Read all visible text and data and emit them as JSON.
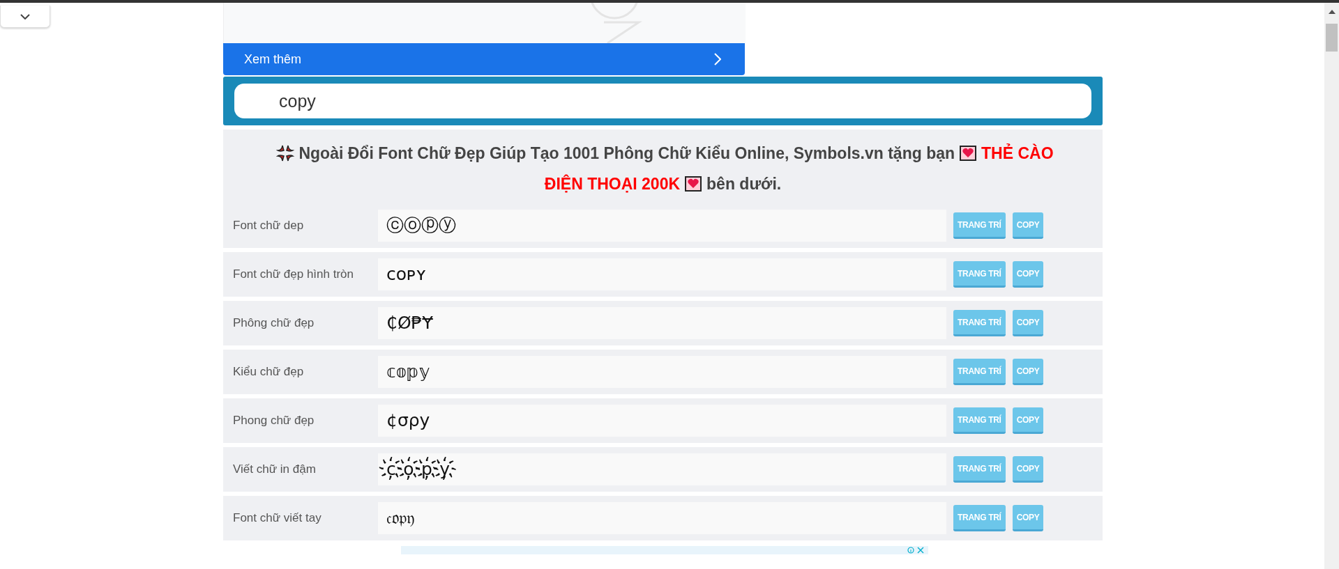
{
  "more_link": {
    "label": "Xem thêm"
  },
  "search": {
    "value": "copy"
  },
  "promo": {
    "text": "Ngoài Đổi Font Chữ Đẹp Giúp Tạo 1001 Phông Chữ Kiểu Online, Symbols.vn tặng bạn",
    "highlight": [
      "THẺ CÀO",
      "ĐIỆN THOẠI 200K"
    ],
    "tail": "bên dưới."
  },
  "rows": [
    {
      "label": "Font chữ dep",
      "value": "ⓒⓞⓟⓨ",
      "buttons": [
        "TRANG TRÍ",
        "COPY"
      ]
    },
    {
      "label": "Font chữ đẹp hình tròn",
      "value": "ᴄᴏᴘʏ",
      "buttons": [
        "TRANG TRÍ",
        "COPY"
      ]
    },
    {
      "label": "Phông chữ đẹp",
      "value": "₵Ø₱Ɏ",
      "buttons": [
        "TRANG TRÍ",
        "COPY"
      ]
    },
    {
      "label": "Kiểu chữ đẹp",
      "value": "𝕔𝕠𝕡𝕪",
      "buttons": [
        "TRANG TRÍ",
        "COPY"
      ]
    },
    {
      "label": "Phong chữ đẹp",
      "value": "¢σρу",
      "buttons": [
        "TRANG TRÍ",
        "COPY"
      ]
    },
    {
      "label": "Viết chữ in đậm",
      "value": "c҉o҉p҉y҉",
      "buttons": [
        "TRANG TRÍ",
        "COPY"
      ]
    },
    {
      "label": "Font chữ viết tay",
      "value": "𝔠𝔬𝔭𝔶",
      "buttons": [
        "TRANG TRÍ",
        "COPY"
      ]
    }
  ]
}
